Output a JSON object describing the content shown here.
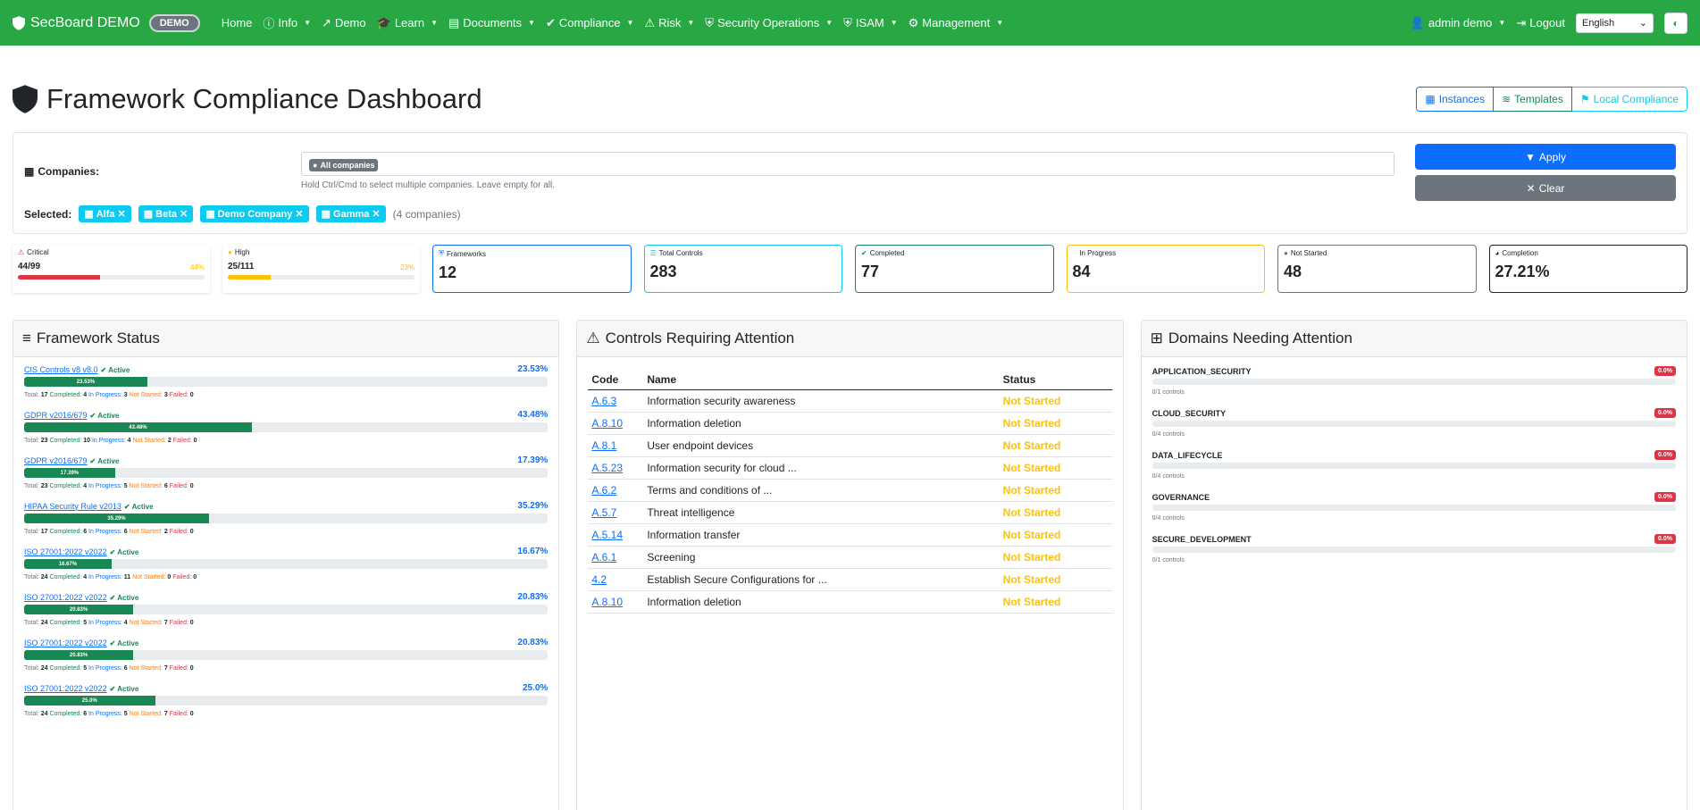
{
  "nav": {
    "brand": "SecBoard DEMO",
    "demo_badge": "DEMO",
    "items": [
      {
        "label": "Home"
      },
      {
        "label": "Info"
      },
      {
        "label": "Demo"
      },
      {
        "label": "Learn"
      },
      {
        "label": "Documents"
      },
      {
        "label": "Compliance"
      },
      {
        "label": "Risk"
      },
      {
        "label": "Security Operations"
      },
      {
        "label": "ISAM"
      },
      {
        "label": "Management"
      }
    ],
    "user": "admin demo",
    "logout": "Logout",
    "language": "English"
  },
  "page": {
    "title": "Framework Compliance Dashboard",
    "buttons": {
      "instances": "Instances",
      "templates": "Templates",
      "local": "Local Compliance"
    }
  },
  "filter": {
    "companies_label": "Companies:",
    "all_chip": "All companies",
    "help": "Hold Ctrl/Cmd to select multiple companies. Leave empty for all.",
    "apply": "Apply",
    "clear": "Clear",
    "selected_label": "Selected:",
    "selected": [
      "Alfa",
      "Beta",
      "Demo Company",
      "Gamma"
    ],
    "count": "(4 companies)"
  },
  "risk": {
    "critical": {
      "label": "Critical",
      "value": "44/99",
      "pct": "44%",
      "fill": 44,
      "color": "#dc3545"
    },
    "high": {
      "label": "High",
      "value": "25/111",
      "pct": "23%",
      "fill": 23,
      "color": "#ffc107"
    }
  },
  "stats": [
    {
      "label": "Frameworks",
      "value": "12",
      "color": "#0d6efd",
      "icon": "shield-icon"
    },
    {
      "label": "Total Controls",
      "value": "283",
      "color": "#0dcaf0",
      "icon": "list-icon"
    },
    {
      "label": "Completed",
      "value": "77",
      "color": "#198754",
      "icon": "check-circle-icon"
    },
    {
      "label": "In Progress",
      "value": "84",
      "color": "#ffc107",
      "icon": "spinner-icon"
    },
    {
      "label": "Not Started",
      "value": "48",
      "color": "#6c757d",
      "icon": "circle-icon"
    },
    {
      "label": "Completion",
      "value": "27.21%",
      "color": "#212529",
      "icon": "pie-chart-icon"
    }
  ],
  "framework_panel": {
    "title": "Framework Status",
    "active_label": "Active",
    "total_label": "Total:",
    "completed_label": "Completed:",
    "inprogress_label": "In Progress:",
    "notstarted_label": "Not Started:",
    "failed_label": "Failed:",
    "items": [
      {
        "name": "CIS Controls v8 v8.0",
        "pct": "23.53%",
        "fill": 23.53,
        "total": "17",
        "completed": "4",
        "inprogress": "3",
        "notstarted": "3",
        "failed": "0"
      },
      {
        "name": "GDPR v2016/679",
        "pct": "43.48%",
        "fill": 43.48,
        "total": "23",
        "completed": "10",
        "inprogress": "4",
        "notstarted": "2",
        "failed": "0"
      },
      {
        "name": "GDPR v2016/679",
        "pct": "17.39%",
        "fill": 17.39,
        "total": "23",
        "completed": "4",
        "inprogress": "5",
        "notstarted": "6",
        "failed": "0"
      },
      {
        "name": "HIPAA Security Rule v2013",
        "pct": "35.29%",
        "fill": 35.29,
        "total": "17",
        "completed": "6",
        "inprogress": "6",
        "notstarted": "2",
        "failed": "0"
      },
      {
        "name": "ISO 27001:2022 v2022",
        "pct": "16.67%",
        "fill": 16.67,
        "total": "24",
        "completed": "4",
        "inprogress": "11",
        "notstarted": "0",
        "failed": "0"
      },
      {
        "name": "ISO 27001:2022 v2022",
        "pct": "20.83%",
        "fill": 20.83,
        "total": "24",
        "completed": "5",
        "inprogress": "4",
        "notstarted": "7",
        "failed": "0"
      },
      {
        "name": "ISO 27001:2022 v2022",
        "pct": "20.83%",
        "fill": 20.83,
        "total": "24",
        "completed": "5",
        "inprogress": "6",
        "notstarted": "7",
        "failed": "0"
      },
      {
        "name": "ISO 27001:2022 v2022",
        "pct": "25.0%",
        "fill": 25.0,
        "total": "24",
        "completed": "6",
        "inprogress": "5",
        "notstarted": "7",
        "failed": "0"
      }
    ]
  },
  "controls_panel": {
    "title": "Controls Requiring Attention",
    "headers": [
      "Code",
      "Name",
      "Status"
    ],
    "rows": [
      {
        "code": "A.6.3",
        "name": "Information security awareness",
        "status": "Not Started"
      },
      {
        "code": "A.8.10",
        "name": "Information deletion",
        "status": "Not Started"
      },
      {
        "code": "A.8.1",
        "name": "User endpoint devices",
        "status": "Not Started"
      },
      {
        "code": "A.5.23",
        "name": "Information security for cloud ...",
        "status": "Not Started"
      },
      {
        "code": "A.6.2",
        "name": "Terms and conditions of ...",
        "status": "Not Started"
      },
      {
        "code": "A.5.7",
        "name": "Threat intelligence",
        "status": "Not Started"
      },
      {
        "code": "A.5.14",
        "name": "Information transfer",
        "status": "Not Started"
      },
      {
        "code": "A.6.1",
        "name": "Screening",
        "status": "Not Started"
      },
      {
        "code": "4.2",
        "name": "Establish Secure Configurations for ...",
        "status": "Not Started"
      },
      {
        "code": "A.8.10",
        "name": "Information deletion",
        "status": "Not Started"
      }
    ]
  },
  "domains_panel": {
    "title": "Domains Needing Attention",
    "items": [
      {
        "name": "APPLICATION_SECURITY",
        "badge": "0.0%",
        "sub": "0/1 controls"
      },
      {
        "name": "CLOUD_SECURITY",
        "badge": "0.0%",
        "sub": "0/4 controls"
      },
      {
        "name": "DATA_LIFECYCLE",
        "badge": "0.0%",
        "sub": "0/4 controls"
      },
      {
        "name": "GOVERNANCE",
        "badge": "0.0%",
        "sub": "0/4 controls"
      },
      {
        "name": "SECURE_DEVELOPMENT",
        "badge": "0.0%",
        "sub": "0/1 controls"
      }
    ]
  }
}
